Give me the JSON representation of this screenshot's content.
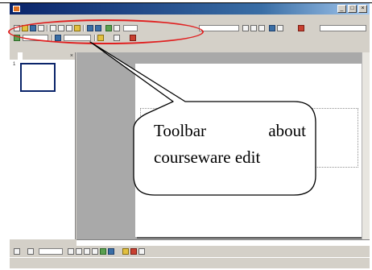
{
  "callout": {
    "line1_word1": "Toolbar",
    "line1_word2": "about",
    "line2": "courseware edit"
  },
  "window": {
    "app_icon": "powerpoint-icon",
    "window_controls": [
      "minimize-icon",
      "maximize-icon",
      "close-icon"
    ]
  },
  "slides_panel": {
    "slide_number": "1"
  },
  "colors": {
    "highlight_ellipse": "#e02020",
    "slide_background": "#ffffff",
    "editor_background": "#a9a9a9",
    "title_bar": "#0a246a",
    "chrome": "#d4d0c8"
  }
}
